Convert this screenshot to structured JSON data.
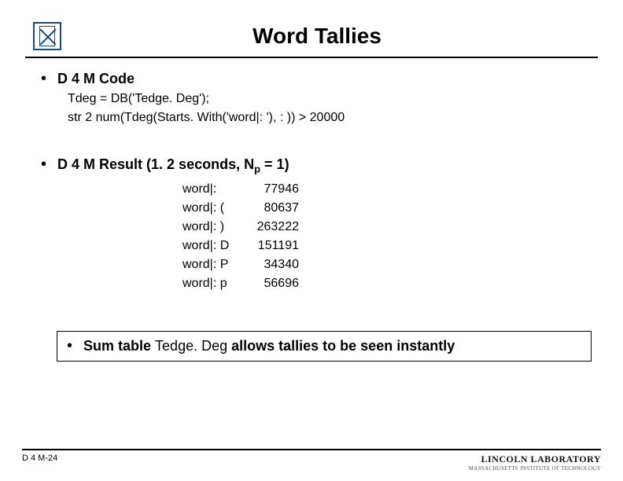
{
  "title": "Word Tallies",
  "section1": {
    "heading": "D 4 M Code",
    "line1": "Tdeg = DB('Tedge. Deg');",
    "line2": "str 2 num(Tdeg(Starts. With('word|: '), : )) > 20000"
  },
  "section2": {
    "heading_prefix": "D 4 M Result (1. 2 seconds, N",
    "heading_subscript": "p",
    "heading_suffix": " = 1)",
    "rows": [
      {
        "key": "word|:",
        "val": "77946"
      },
      {
        "key": "word|: (",
        "val": "80637"
      },
      {
        "key": "word|: )",
        "val": "263222"
      },
      {
        "key": "word|: D",
        "val": "151191"
      },
      {
        "key": "word|: P",
        "val": "34340"
      },
      {
        "key": "word|: p",
        "val": "56696"
      }
    ]
  },
  "summary": {
    "prefix": "Sum table ",
    "mid": "Tedge. Deg ",
    "suffix": "allows tallies to be seen instantly"
  },
  "footer": {
    "page": "D 4 M-24",
    "lab": "LINCOLN LABORATORY",
    "labsub": "MASSACHUSETTS INSTITUTE OF TECHNOLOGY"
  }
}
